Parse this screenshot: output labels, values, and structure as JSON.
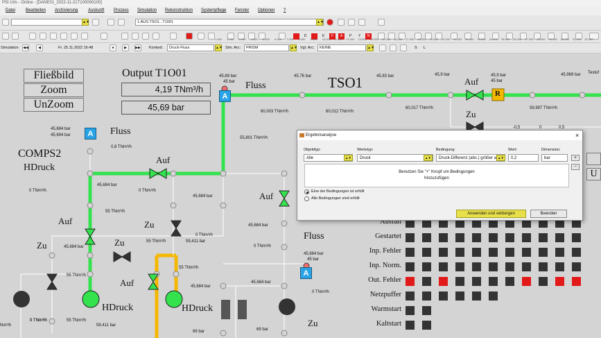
{
  "window": {
    "title": "PSI Urls - Online - [DANE01_2022-11-21T100000100]"
  },
  "menu": [
    "Datei",
    "Bearbeiten",
    "Archivierung",
    "Auskunft",
    "Prozess",
    "Simulation",
    "Rekonstruktion",
    "Systempflege",
    "Fenster",
    "Optionen",
    "?"
  ],
  "toolbar": {
    "object_path": "1.AUS.TSO1...T1001",
    "sim_label": "Simulation",
    "sim_time": "Fr. 25.11.2022 16:48",
    "kontext_label": "Kontext:",
    "kontext_value": "Druck-Fluss",
    "sim_arc_label": "Sim. Arc:",
    "sim_arc_value": "PRISM",
    "vgl_arc_label": "Vgl. Arc:",
    "vgl_arc_value": "KEINE",
    "color_keys": [
      "D",
      "K",
      "F",
      "A",
      "P",
      "Y",
      "N"
    ],
    "letters": [
      "S",
      "L"
    ]
  },
  "ruler": {
    "ticks": [
      "1.000",
      "2.000",
      "3.000",
      "4.000",
      "5.000",
      "6.000",
      "7.000",
      "8.000",
      "9.000",
      "10.000",
      "11.000",
      "12.000",
      "13.000",
      "14.000",
      "15.000",
      "16.000",
      "17.000",
      "18.000",
      "19.000",
      "20.000",
      "21.000",
      "22.000",
      "23.000",
      "24.000",
      "25.000",
      "26.000",
      "27.000",
      "28.000",
      "29.000",
      "30.000",
      "31.000",
      "32.000"
    ]
  },
  "panel": {
    "btn_fliessbild": "Fließbild",
    "btn_zoom": "Zoom",
    "btn_unzoom": "UnZoom",
    "output_title": "Output T1O01",
    "output_flow": "4,19 TNm³/h",
    "output_pressure": "45,69 bar"
  },
  "diagram": {
    "tso1": "TSO1",
    "comps2": "COMPS2",
    "hdruck": "HDruck",
    "fluss": "Fluss",
    "auf": "Auf",
    "zu": "Zu",
    "box_a": "A",
    "box_r": "R",
    "labels": [
      {
        "t": "45,69 bar",
        "n": "p1"
      },
      {
        "t": "45 bar",
        "n": "p2"
      },
      {
        "t": "45,76 bar",
        "n": "p3"
      },
      {
        "t": "45,83 bar",
        "n": "p4"
      },
      {
        "t": "45,9 bar",
        "n": "p5"
      },
      {
        "t": "45,9 bar",
        "n": "p6"
      },
      {
        "t": "45 bar",
        "n": "p7"
      },
      {
        "t": "45,969 bar",
        "n": "p8"
      },
      {
        "t": "60,003 TNm³/h",
        "n": "f1"
      },
      {
        "t": "60,012 TNm³/h",
        "n": "f2"
      },
      {
        "t": "60,017 TNm³/h",
        "n": "f3"
      },
      {
        "t": "59,997 TNm³/h",
        "n": "f4"
      },
      {
        "t": "55,801 TNm³/h",
        "n": "f5"
      },
      {
        "t": "45,684 bar",
        "n": "p9"
      },
      {
        "t": "45,694 bar",
        "n": "p10"
      },
      {
        "t": "0,8 TNm³/h",
        "n": "f6"
      },
      {
        "t": "0 TNm³/h",
        "n": "f7"
      },
      {
        "t": "45,684 bar",
        "n": "p11"
      },
      {
        "t": "0 TNm³/h",
        "n": "f8"
      },
      {
        "t": "55 TNm³/h",
        "n": "f9"
      },
      {
        "t": "45,684 bar",
        "n": "p12"
      },
      {
        "t": "45,684 bar",
        "n": "p13"
      },
      {
        "t": "55 TNm³/h",
        "n": "f10"
      },
      {
        "t": "0 TNm³/h",
        "n": "f11"
      },
      {
        "t": "59,411 bar",
        "n": "p14"
      },
      {
        "t": "55 TNm³/h",
        "n": "f12"
      },
      {
        "t": "55 TNm³/h",
        "n": "f13"
      },
      {
        "t": "45,684 bar",
        "n": "p15"
      },
      {
        "t": "0 TNm³/h",
        "n": "f14"
      },
      {
        "t": "45,684 bar",
        "n": "p16"
      },
      {
        "t": "45 bar",
        "n": "p17"
      },
      {
        "t": "45,684 bar",
        "n": "p18"
      },
      {
        "t": "0 TNm³/h",
        "n": "f15"
      },
      {
        "t": "0 TNm³/h",
        "n": "f16"
      },
      {
        "t": "45,684 bar",
        "n": "p19"
      },
      {
        "t": "0 TNm³/h",
        "n": "f17"
      },
      {
        "t": "55 TNm³/h",
        "n": "f18"
      },
      {
        "t": "59,411 bar",
        "n": "p20"
      },
      {
        "t": "69 bar",
        "n": "p21"
      },
      {
        "t": "69 bar",
        "n": "p22"
      },
      {
        "t": "Nm³/h",
        "n": "f19"
      },
      {
        "t": "-0,5",
        "n": "s1"
      },
      {
        "t": "0",
        "n": "s2"
      },
      {
        "t": "0,5",
        "n": "s3"
      },
      {
        "t": "Testuf",
        "n": "s4"
      }
    ]
  },
  "status": {
    "rows": [
      {
        "label": "Ausfall",
        "cells": [
          0,
          0,
          0,
          0,
          0,
          0,
          0,
          0,
          0,
          0,
          0
        ]
      },
      {
        "label": "Gestartet",
        "cells": [
          0,
          0,
          0,
          0,
          0,
          0,
          0,
          0,
          0,
          0,
          0
        ]
      },
      {
        "label": "Inp. Fehler",
        "cells": [
          0,
          0,
          0,
          0,
          0,
          0,
          0,
          0,
          0,
          0,
          0
        ]
      },
      {
        "label": "Inp. Norm.",
        "cells": [
          0,
          0,
          0,
          0,
          0,
          0,
          0,
          0,
          0,
          0,
          0
        ]
      },
      {
        "label": "Out. Fehler",
        "cells": [
          1,
          0,
          1,
          0,
          0,
          0,
          0,
          1,
          0,
          1,
          1
        ]
      },
      {
        "label": "Netzpuffer",
        "cells": [
          0,
          0,
          0,
          0,
          0,
          0
        ]
      },
      {
        "label": "Warmstart",
        "cells": [
          0,
          0
        ]
      },
      {
        "label": "Kaltstart",
        "cells": [
          0,
          0
        ]
      }
    ]
  },
  "dialog": {
    "title": "Ergebnisanalyse",
    "objekttyp_label": "Objekttyp:",
    "objekttyp_value": "Alle",
    "wertetyp_label": "Wertetyp:",
    "wertetyp_value": "Druck",
    "bedingung_label": "Bedingung:",
    "bedingung_value": "Druck-Differenz (abs.) größer al",
    "wert_label": "Wert:",
    "wert_value": "0,2",
    "dimension_label": "Dimension:",
    "dimension_value": "bar",
    "info_line1": "Benutzen Sie \"+\" Knopf um Bedingungen",
    "info_line2": "hinzuzufügen",
    "radio1": "Eine der Bedingungen ist erfüllt",
    "radio2": "Alle Bedingungen sind erfüllt",
    "apply_btn": "Anwenden und verbergen",
    "end_btn": "Beenden",
    "close": "×",
    "plus": "+",
    "minus": "−",
    "dd": "▲▼"
  },
  "colors": {
    "green": "#33e24d",
    "yellow": "#f5b800",
    "accent_blue": "#29a3e5",
    "red": "#e21919"
  }
}
